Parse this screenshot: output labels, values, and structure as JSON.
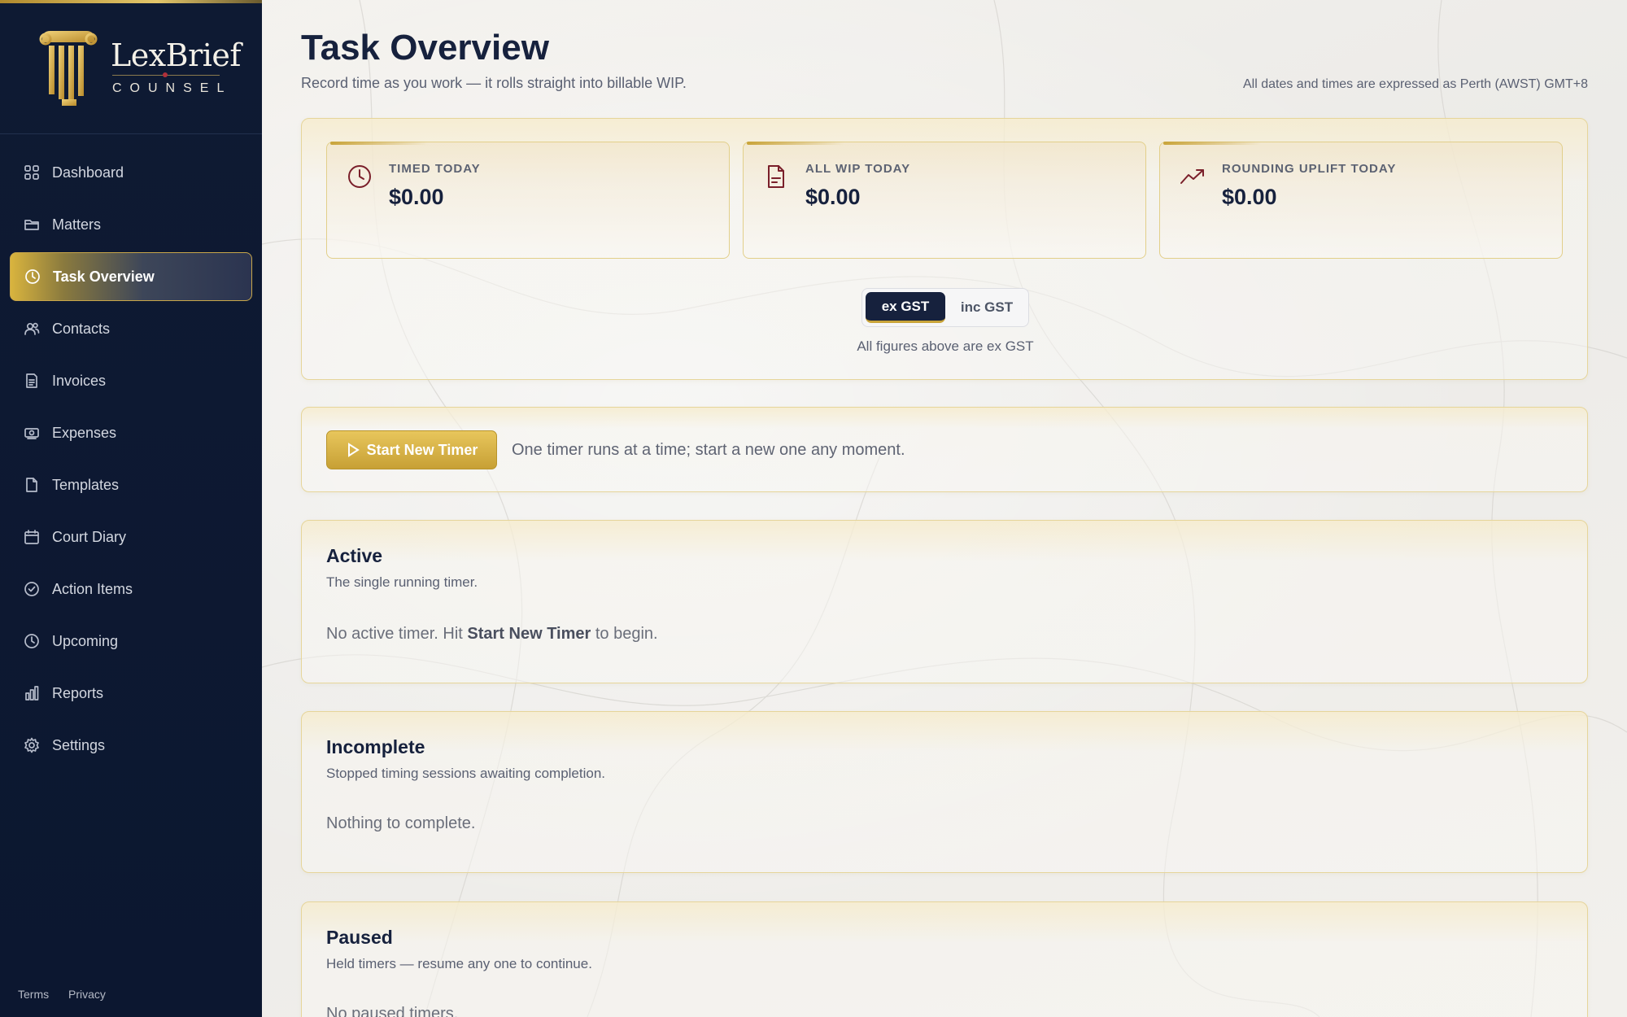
{
  "brand": {
    "name": "LexBrief",
    "sub": "COUNSEL"
  },
  "nav": [
    {
      "label": "Dashboard",
      "icon": "grid-icon"
    },
    {
      "label": "Matters",
      "icon": "folder-icon"
    },
    {
      "label": "Task Overview",
      "icon": "clock-icon",
      "active": true
    },
    {
      "label": "Contacts",
      "icon": "users-icon"
    },
    {
      "label": "Invoices",
      "icon": "invoice-icon"
    },
    {
      "label": "Expenses",
      "icon": "banknote-icon"
    },
    {
      "label": "Templates",
      "icon": "file-icon"
    },
    {
      "label": "Court Diary",
      "icon": "calendar-icon"
    },
    {
      "label": "Action Items",
      "icon": "check-circle-icon"
    },
    {
      "label": "Upcoming",
      "icon": "clock-icon"
    },
    {
      "label": "Reports",
      "icon": "bar-chart-icon"
    },
    {
      "label": "Settings",
      "icon": "gear-icon"
    }
  ],
  "footer": {
    "terms": "Terms",
    "privacy": "Privacy"
  },
  "header": {
    "title": "Task Overview",
    "subtitle": "Record time as you work — it rolls straight into billable WIP.",
    "tz_note": "All dates and times are expressed as Perth (AWST) GMT+8"
  },
  "stats": [
    {
      "label": "TIMED TODAY",
      "value": "$0.00",
      "icon": "clock-icon"
    },
    {
      "label": "ALL WIP TODAY",
      "value": "$0.00",
      "icon": "document-icon"
    },
    {
      "label": "ROUNDING UPLIFT TODAY",
      "value": "$0.00",
      "icon": "trending-up-icon"
    }
  ],
  "gst_toggle": {
    "ex": "ex GST",
    "inc": "inc GST",
    "selected": "ex GST",
    "note": "All figures above are ex GST"
  },
  "timer": {
    "button": "Start New Timer",
    "hint": "One timer runs at a time; start a new one any moment."
  },
  "sections": {
    "active": {
      "title": "Active",
      "desc": "The single running timer.",
      "empty_pre": "No active timer. Hit ",
      "empty_bold": "Start New Timer",
      "empty_post": " to begin."
    },
    "incomplete": {
      "title": "Incomplete",
      "desc": "Stopped timing sessions awaiting completion.",
      "empty": "Nothing to complete."
    },
    "paused": {
      "title": "Paused",
      "desc": "Held timers — resume any one to continue.",
      "empty": "No paused timers."
    }
  },
  "colors": {
    "navy": "#16213d",
    "gold": "#c9a43a",
    "burgundy": "#7a1f2a",
    "sidebar": "#0e1a33"
  }
}
